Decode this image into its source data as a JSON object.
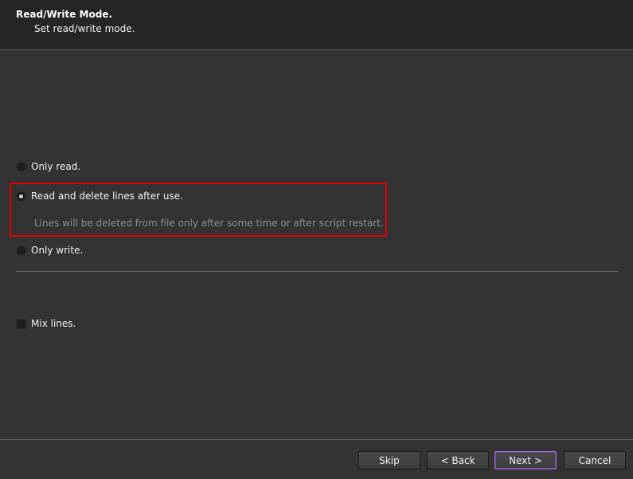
{
  "header": {
    "title": "Read/Write Mode.",
    "subtitle": "Set read/write mode."
  },
  "options": [
    {
      "label": "Only read.",
      "checked": false
    },
    {
      "label": "Read and delete lines after use.",
      "checked": true
    },
    {
      "label": "Only write.",
      "checked": false
    }
  ],
  "hint": "Lines will be deleted from file only after some time or after script restart.",
  "mix_lines": {
    "label": "Mix lines.",
    "checked": false
  },
  "buttons": {
    "skip": "Skip",
    "back": "< Back",
    "next": "Next >",
    "cancel": "Cancel"
  },
  "colors": {
    "highlight": "#e00000",
    "default_button_border": "#9b6fd0"
  }
}
